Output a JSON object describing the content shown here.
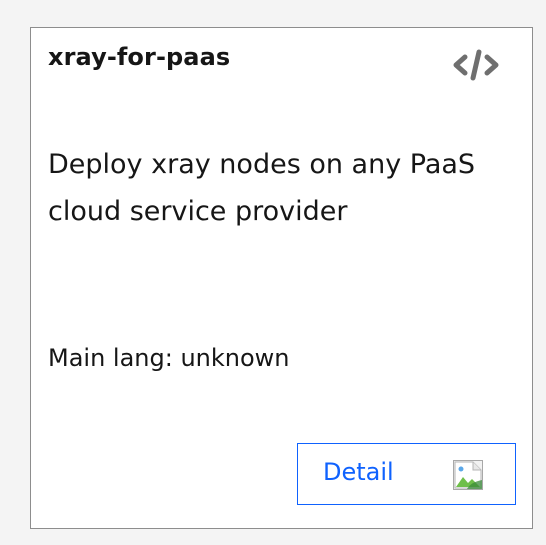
{
  "card": {
    "title": "xray-for-paas",
    "description": "Deploy xray nodes on any PaaS cloud service provider",
    "main_lang": "Main lang: unknown",
    "detail_button_label": "Detail",
    "code_icon": "code-icon",
    "detail_image_icon": "broken-image-icon"
  },
  "colors": {
    "accent": "#0f62fe",
    "card_border": "#8d8d8d",
    "text": "#161616",
    "page_background": "#f4f4f4",
    "icon": "#525252"
  }
}
